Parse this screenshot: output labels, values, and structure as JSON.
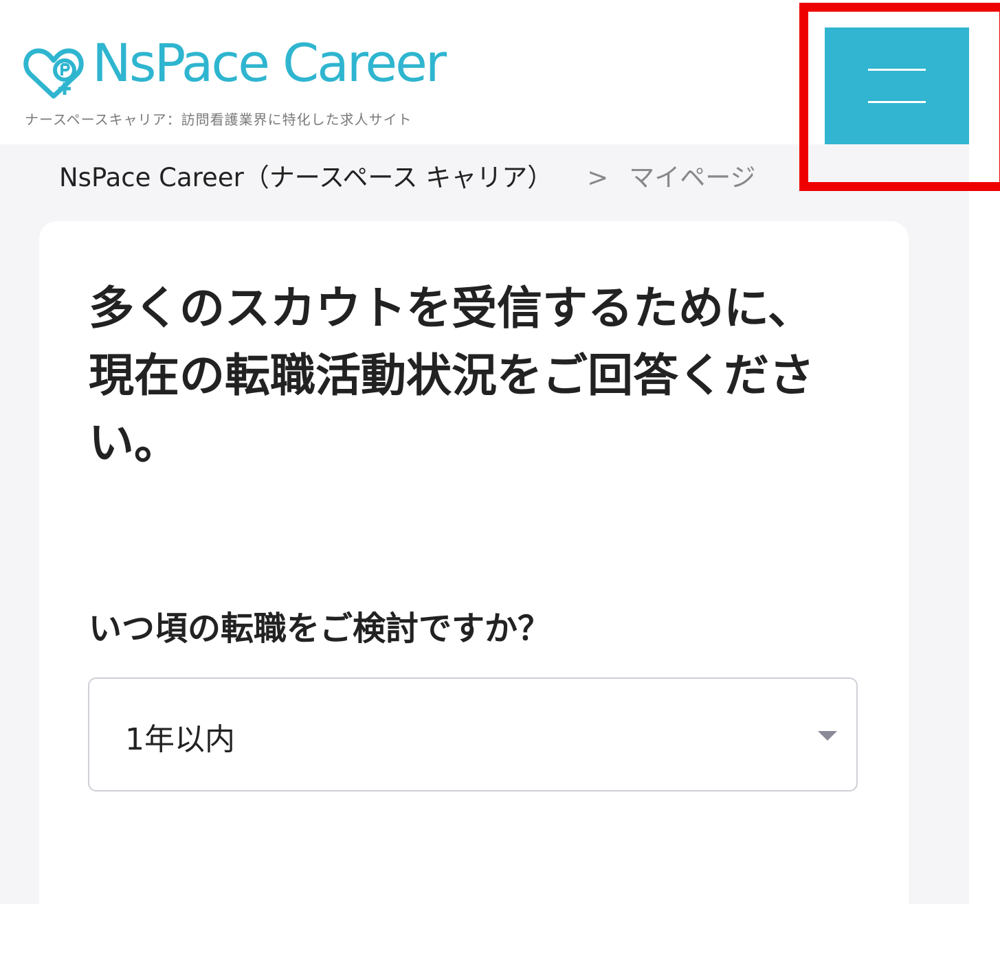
{
  "header": {
    "logo_text": "NsPace Career",
    "tagline": "ナースペースキャリア：訪問看護業界に特化した求人サイト",
    "brand_color": "#2fb5cf",
    "menu_button_color": "#31b5d0",
    "menu_icon": "hamburger-menu-icon"
  },
  "highlight_color": "#ee0000",
  "breadcrumb": {
    "home": "NsPace Career（ナースペース キャリア）",
    "separator": ">",
    "current": "マイページ"
  },
  "main": {
    "heading_line1": "多くのスカウトを受信するために、",
    "heading_line2": "現在の転職活動状況をご回答ください。",
    "question": "いつ頃の転職をご検討ですか？",
    "select": {
      "selected": "1年以内"
    }
  }
}
